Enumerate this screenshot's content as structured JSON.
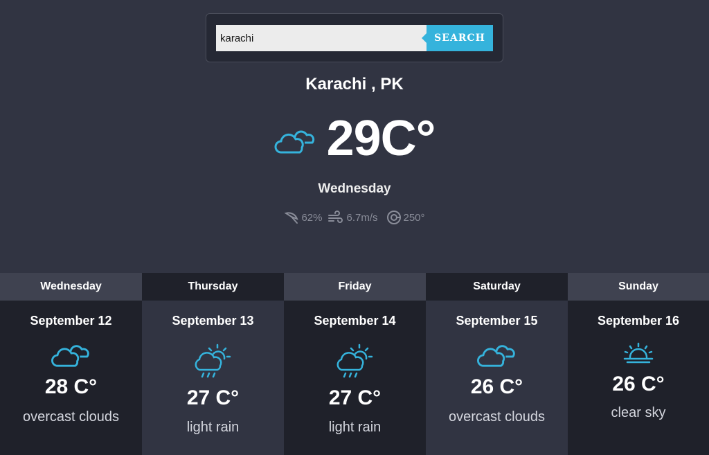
{
  "search": {
    "value": "karachi",
    "button_label": "SEARCH"
  },
  "current": {
    "location": "Karachi , PK",
    "temperature": "29C°",
    "icon": "cloud-icon",
    "day": "Wednesday",
    "humidity": "62%",
    "wind_speed": "6.7m/s",
    "wind_direction": "250°"
  },
  "colors": {
    "accent": "#35b3dc",
    "background": "#313442",
    "panel_dark": "#1f212a",
    "panel_header": "#3f4250"
  },
  "forecast": [
    {
      "day": "Wednesday",
      "date": "September 12",
      "temp": "28 C°",
      "description": "overcast clouds",
      "icon": "clouds-icon"
    },
    {
      "day": "Thursday",
      "date": "September 13",
      "temp": "27 C°",
      "description": "light rain",
      "icon": "sun-rain-icon"
    },
    {
      "day": "Friday",
      "date": "September 14",
      "temp": "27 C°",
      "description": "light rain",
      "icon": "sun-rain-icon"
    },
    {
      "day": "Saturday",
      "date": "September 15",
      "temp": "26 C°",
      "description": "overcast clouds",
      "icon": "clouds-icon"
    },
    {
      "day": "Sunday",
      "date": "September 16",
      "temp": "26 C°",
      "description": "clear sky",
      "icon": "sunrise-icon"
    }
  ]
}
